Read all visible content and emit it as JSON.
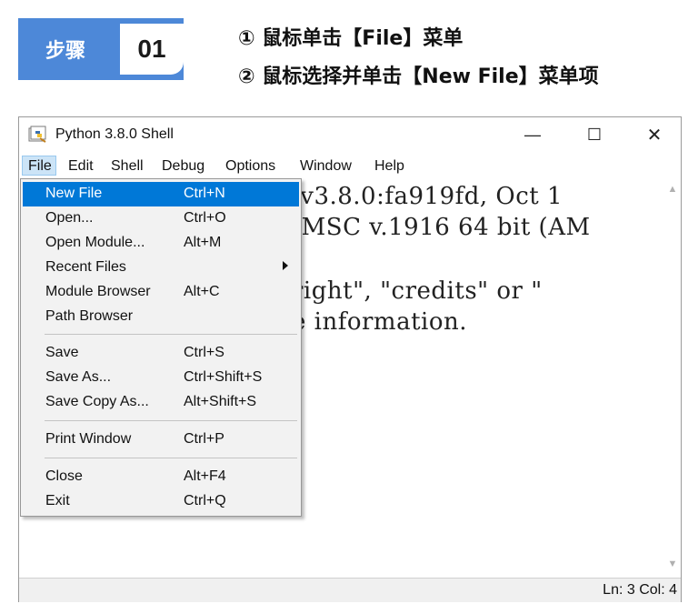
{
  "step": {
    "label": "步骤",
    "number": "01",
    "instruction_1": "① 鼠标单击【File】菜单",
    "instruction_2": "② 鼠标选择并单击【New File】菜单项"
  },
  "window": {
    "title": "Python 3.8.0 Shell",
    "controls": {
      "minimize": "—",
      "maximize": "☐",
      "close": "✕"
    }
  },
  "menubar": {
    "items": [
      "File",
      "Edit",
      "Shell",
      "Debug",
      "Options",
      "Window",
      "Help"
    ]
  },
  "editor": {
    "lines": [
      "/v3.8.0:fa919fd, Oct 1",
      "[MSC v.1916 64 bit (AM",
      "right\", \"credits\" or \"",
      "e information."
    ]
  },
  "status": {
    "text": "Ln: 3  Col: 4"
  },
  "file_menu": {
    "items": [
      {
        "label": "New File",
        "accel": "Ctrl+N"
      },
      {
        "label": "Open...",
        "accel": "Ctrl+O"
      },
      {
        "label": "Open Module...",
        "accel": "Alt+M"
      },
      {
        "label": "Recent Files",
        "accel": ""
      },
      {
        "label": "Module Browser",
        "accel": "Alt+C"
      },
      {
        "label": "Path Browser",
        "accel": ""
      },
      {
        "label": "Save",
        "accel": "Ctrl+S"
      },
      {
        "label": "Save As...",
        "accel": "Ctrl+Shift+S"
      },
      {
        "label": "Save Copy As...",
        "accel": "Alt+Shift+S"
      },
      {
        "label": "Print Window",
        "accel": "Ctrl+P"
      },
      {
        "label": "Close",
        "accel": "Alt+F4"
      },
      {
        "label": "Exit",
        "accel": "Ctrl+Q"
      }
    ],
    "highlighted": "New File"
  },
  "colors": {
    "badge": "#4d88d8",
    "highlight": "#0078d7",
    "menu_bg": "#f2f2f2"
  }
}
